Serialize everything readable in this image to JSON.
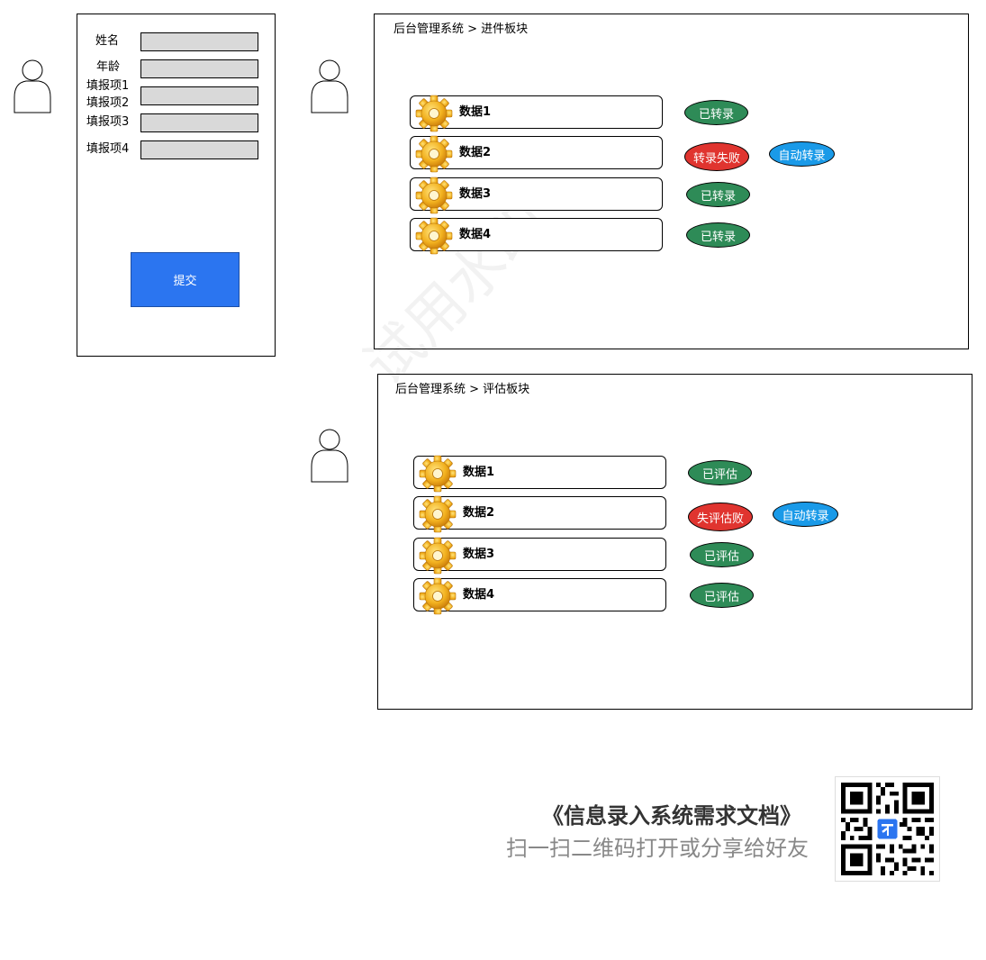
{
  "form": {
    "fields": [
      {
        "label": "姓名"
      },
      {
        "label": "年龄"
      },
      {
        "label": "填报项1"
      },
      {
        "label": "填报项2"
      },
      {
        "label": "填报项3"
      },
      {
        "label": "填报项4"
      }
    ],
    "submit_label": "提交"
  },
  "transfer_panel": {
    "title": "后台管理系统 > 进件板块",
    "rows": [
      {
        "label": "数据1",
        "status": "已转录"
      },
      {
        "label": "数据2",
        "status": "转录失败",
        "action": "自动转录"
      },
      {
        "label": "数据3",
        "status": "已转录"
      },
      {
        "label": "数据4",
        "status": "已转录"
      }
    ]
  },
  "eval_panel": {
    "title": "后台管理系统 > 评估板块",
    "rows": [
      {
        "label": "数据1",
        "status": "已评估"
      },
      {
        "label": "数据2",
        "status": "失评估败",
        "action": "自动转录"
      },
      {
        "label": "数据3",
        "status": "已评估"
      },
      {
        "label": "数据4",
        "status": "已评估"
      }
    ]
  },
  "watermark": "试用水印",
  "share": {
    "doc_title": "《信息录入系统需求文档》",
    "subtitle": "扫一扫二维码打开或分享给好友"
  },
  "colors": {
    "submit": "#2b75f0",
    "success": "#2e8b57",
    "failure": "#e0342f",
    "action": "#1a9ae8",
    "input": "#d9d9d9"
  },
  "icons": {
    "person": "person-icon",
    "gear": "gear-icon",
    "qr": "qr-code-icon"
  }
}
